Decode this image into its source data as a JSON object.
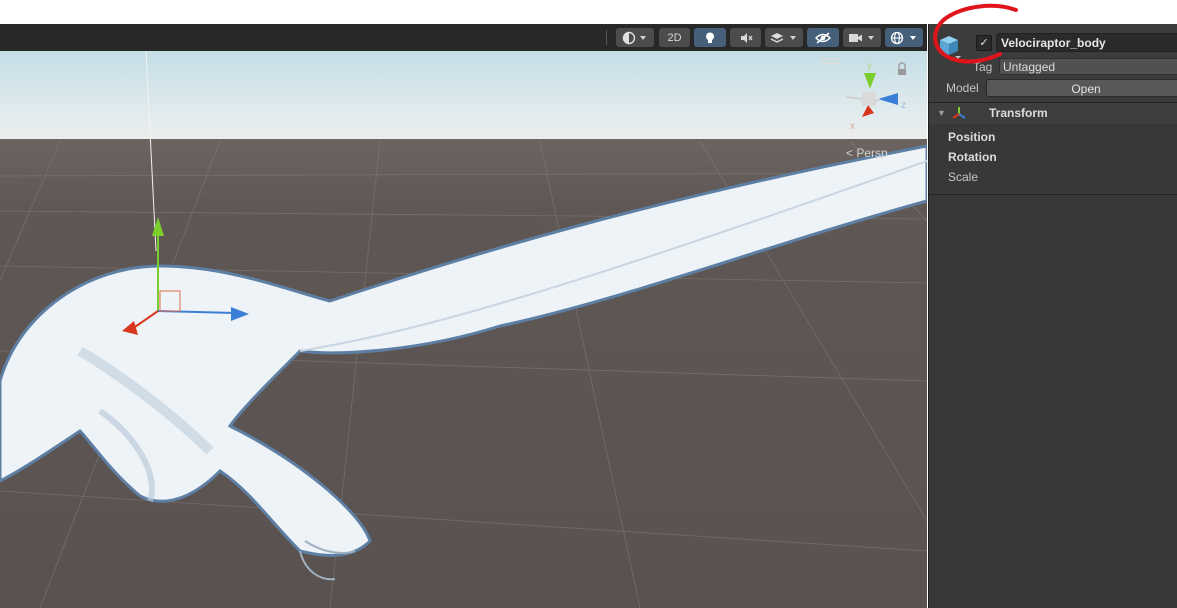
{
  "scene_toolbar": {
    "button_2d": "2D",
    "icons": [
      "draw-mode-icon",
      "lighting-bulb-icon",
      "audio-mute-icon",
      "effects-layers-icon",
      "hidden-visibility-icon",
      "camera-icon",
      "gizmos-globe-icon"
    ]
  },
  "viewport": {
    "projection_label": "< Persp",
    "gizmo_axes": [
      "y",
      "z",
      "x"
    ],
    "colors": {
      "ground": "#5e5652",
      "sky": "#cfe3ea",
      "horizon": "#e9eaea",
      "selection_outline": "#5e7fa4",
      "fur": "#f4f8fb",
      "axis_y": "#7bcf2d",
      "axis_z": "#3b7fd9",
      "axis_x": "#d8361f"
    }
  },
  "inspector": {
    "object_name": "Velociraptor_body",
    "active_checked": true,
    "checkmark": "✓",
    "tag_label": "Tag",
    "tag_value": "Untagged",
    "model_label": "Model",
    "open_button": "Open",
    "component_title": "Transform",
    "properties": [
      "Position",
      "Rotation",
      "Scale"
    ],
    "icon_names": [
      "prefab-cube-icon",
      "foldout-arrow-icon",
      "transform-axes-icon",
      "lock-icon"
    ]
  },
  "annotation": {
    "color": "#e0141b"
  }
}
